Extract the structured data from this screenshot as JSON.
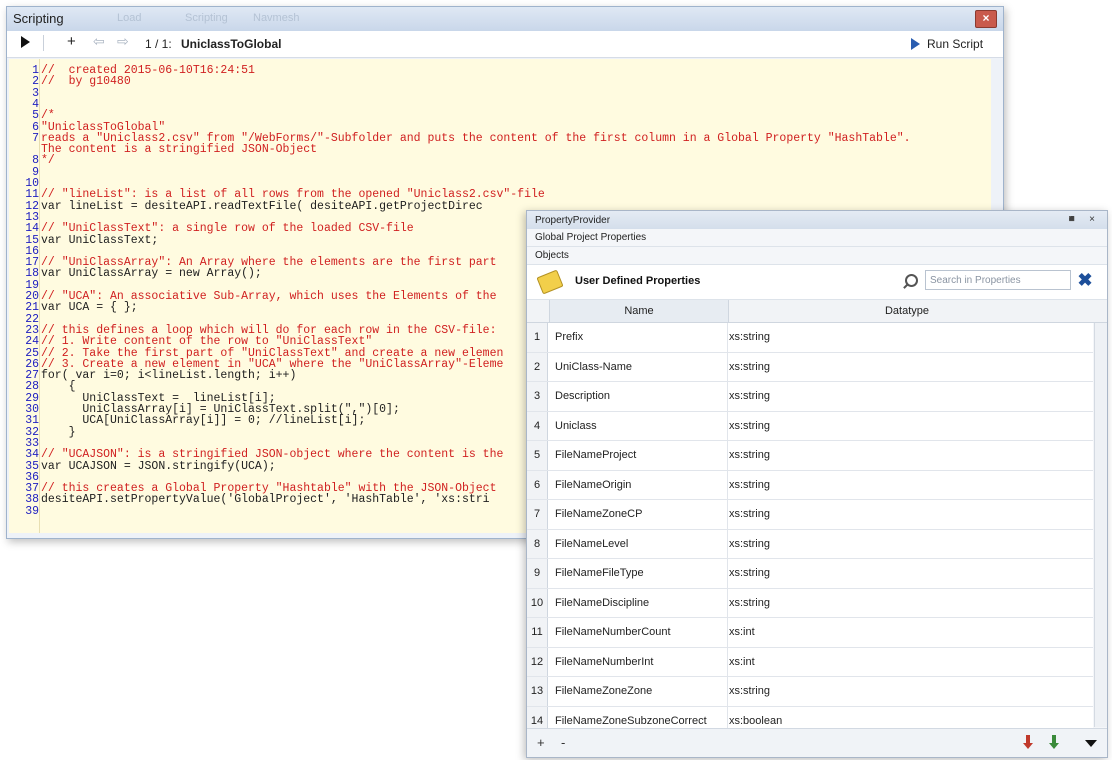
{
  "scripting": {
    "title": "Scripting",
    "ghost_tabs": [
      "Load",
      "Scripting",
      "Navmesh"
    ],
    "toolbar": {
      "add": "+",
      "position": "1 / 1:",
      "script_name": "UniclassToGlobal",
      "run_label": "Run Script"
    },
    "code_lines": [
      {
        "n": "1",
        "t": "//  created 2015-06-10T16:24:51",
        "k": "comment"
      },
      {
        "n": "2",
        "t": "//  by g10480",
        "k": "comment"
      },
      {
        "n": "3",
        "t": "",
        "k": "code"
      },
      {
        "n": "4",
        "t": "",
        "k": "code"
      },
      {
        "n": "5",
        "t": "/*",
        "k": "comment"
      },
      {
        "n": "6",
        "t": "\"UniclassToGlobal\"",
        "k": "comment"
      },
      {
        "n": "7",
        "t": "reads a \"Uniclass2.csv\" from \"/WebForms/\"-Subfolder and puts the content of the first column in a Global Property \"HashTable\".",
        "k": "comment"
      },
      {
        "n": "",
        "t": "The content is a stringified JSON-Object",
        "k": "comment"
      },
      {
        "n": "8",
        "t": "*/",
        "k": "comment"
      },
      {
        "n": "9",
        "t": "",
        "k": "code"
      },
      {
        "n": "10",
        "t": "",
        "k": "code"
      },
      {
        "n": "11",
        "t": "// \"lineList\": is a list of all rows from the opened \"Uniclass2.csv\"-file",
        "k": "comment"
      },
      {
        "n": "12",
        "t": "var lineList = desiteAPI.readTextFile( desiteAPI.getProjectDirec",
        "k": "code"
      },
      {
        "n": "13",
        "t": "",
        "k": "code"
      },
      {
        "n": "14",
        "t": "// \"UniClassText\": a single row of the loaded CSV-file",
        "k": "comment"
      },
      {
        "n": "15",
        "t": "var UniClassText;",
        "k": "code"
      },
      {
        "n": "16",
        "t": "",
        "k": "code"
      },
      {
        "n": "17",
        "t": "// \"UniClassArray\": An Array where the elements are the first part",
        "k": "comment"
      },
      {
        "n": "18",
        "t": "var UniClassArray = new Array();",
        "k": "code"
      },
      {
        "n": "19",
        "t": "",
        "k": "code"
      },
      {
        "n": "20",
        "t": "// \"UCA\": An associative Sub-Array, which uses the Elements of the",
        "k": "comment"
      },
      {
        "n": "21",
        "t": "var UCA = { };",
        "k": "code"
      },
      {
        "n": "22",
        "t": "",
        "k": "code"
      },
      {
        "n": "23",
        "t": "// this defines a loop which will do for each row in the CSV-file:",
        "k": "comment"
      },
      {
        "n": "24",
        "t": "// 1. Write content of the row to \"UniClassText\"",
        "k": "comment"
      },
      {
        "n": "25",
        "t": "// 2. Take the first part of \"UniClassText\" and create a new elemen",
        "k": "comment"
      },
      {
        "n": "26",
        "t": "// 3. Create a new element in \"UCA\" where the \"UniClassArray\"-Eleme",
        "k": "comment"
      },
      {
        "n": "27",
        "t": "for( var i=0; i<lineList.length; i++)",
        "k": "code"
      },
      {
        "n": "28",
        "t": "    {",
        "k": "code"
      },
      {
        "n": "29",
        "t": "      UniClassText =  lineList[i];",
        "k": "code"
      },
      {
        "n": "30",
        "t": "      UniClassArray[i] = UniClassText.split(\",\")[0];",
        "k": "code"
      },
      {
        "n": "31",
        "t": "      UCA[UniClassArray[i]] = 0; //lineList[i];",
        "k": "code"
      },
      {
        "n": "32",
        "t": "    }",
        "k": "code"
      },
      {
        "n": "33",
        "t": "",
        "k": "code"
      },
      {
        "n": "34",
        "t": "// \"UCAJSON\": is a stringified JSON-object where the content is the",
        "k": "comment"
      },
      {
        "n": "35",
        "t": "var UCAJSON = JSON.stringify(UCA);",
        "k": "code"
      },
      {
        "n": "36",
        "t": "",
        "k": "code"
      },
      {
        "n": "37",
        "t": "// this creates a Global Property \"Hashtable\" with the JSON-Object",
        "k": "comment"
      },
      {
        "n": "38",
        "t": "desiteAPI.setPropertyValue('GlobalProject', 'HashTable', 'xs:stri",
        "k": "code"
      },
      {
        "n": "39",
        "t": "",
        "k": "code"
      }
    ]
  },
  "property_provider": {
    "title": "PropertyProvider",
    "window_controls": "◾ ×",
    "subtitle": "Global Project Properties",
    "section": "Objects",
    "heading": "User Defined Properties",
    "search_placeholder": "Search in Properties",
    "columns": {
      "name": "Name",
      "datatype": "Datatype"
    },
    "rows": [
      {
        "idx": "1",
        "name": "Prefix",
        "type": "xs:string"
      },
      {
        "idx": "2",
        "name": "UniClass-Name",
        "type": "xs:string"
      },
      {
        "idx": "3",
        "name": "Description",
        "type": "xs:string"
      },
      {
        "idx": "4",
        "name": "Uniclass",
        "type": "xs:string"
      },
      {
        "idx": "5",
        "name": "FileNameProject",
        "type": "xs:string"
      },
      {
        "idx": "6",
        "name": "FileNameOrigin",
        "type": "xs:string"
      },
      {
        "idx": "7",
        "name": "FileNameZoneCP",
        "type": "xs:string"
      },
      {
        "idx": "8",
        "name": "FileNameLevel",
        "type": "xs:string"
      },
      {
        "idx": "9",
        "name": "FileNameFileType",
        "type": "xs:string"
      },
      {
        "idx": "10",
        "name": "FileNameDiscipline",
        "type": "xs:string"
      },
      {
        "idx": "11",
        "name": "FileNameNumberCount",
        "type": "xs:int"
      },
      {
        "idx": "12",
        "name": "FileNameNumberInt",
        "type": "xs:int"
      },
      {
        "idx": "13",
        "name": "FileNameZoneZone",
        "type": "xs:string"
      },
      {
        "idx": "14",
        "name": "FileNameZoneSubzoneCorrect",
        "type": "xs:boolean"
      }
    ],
    "footer": {
      "add": "+",
      "remove": "-"
    }
  },
  "colors": {
    "comment": "#d02020",
    "code": "#202020",
    "keyword": "#2020c0",
    "editor_bg": "#fffbe0"
  }
}
